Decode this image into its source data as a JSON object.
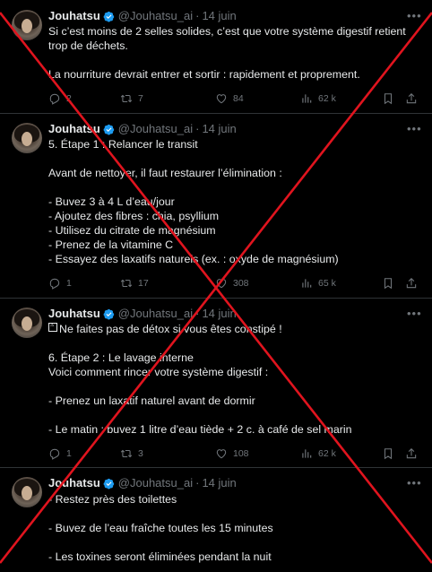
{
  "tweets": [
    {
      "name": "Jouhatsu",
      "handle": "@Jouhatsu_ai",
      "sep": "·",
      "date": "14 juin",
      "body": "Si c’est moins de 2 selles solides, c’est que votre système digestif retient trop de déchets.\n\nLa nourriture devrait entrer et sortir : rapidement et proprement.",
      "replies": "2",
      "retweets": "7",
      "likes": "84",
      "views": "62 k"
    },
    {
      "name": "Jouhatsu",
      "handle": "@Jouhatsu_ai",
      "sep": "·",
      "date": "14 juin",
      "body": "5. Étape 1 : Relancer le transit\n\nAvant de nettoyer, il faut restaurer l’élimination :\n\n- Buvez 3 à 4 L d’eau/jour\n- Ajoutez des fibres : chia, psyllium\n- Utilisez du citrate de magnésium\n- Prenez de la vitamine C\n- Essayez des laxatifs naturels (ex. : oxyde de magnésium)",
      "replies": "1",
      "retweets": "17",
      "likes": "308",
      "views": "65 k"
    },
    {
      "name": "Jouhatsu",
      "handle": "@Jouhatsu_ai",
      "sep": "·",
      "date": "14 juin",
      "emoji": "⚠",
      "body": "Ne faites pas de détox si vous êtes constipé !\n\n6. Étape 2 : Le lavage interne\nVoici comment rincer votre système digestif :\n\n- Prenez un laxatif naturel avant de dormir\n\n- Le matin : buvez 1 litre d’eau tiède + 2 c. à café de sel marin",
      "replies": "1",
      "retweets": "3",
      "likes": "108",
      "views": "62 k"
    },
    {
      "name": "Jouhatsu",
      "handle": "@Jouhatsu_ai",
      "sep": "·",
      "date": "14 juin",
      "body": "- Restez près des toilettes\n\n- Buvez de l’eau fraîche toutes les 15 minutes\n\n- Les toxines seront éliminées pendant la nuit"
    }
  ],
  "colors": {
    "background": "#000000",
    "text": "#e7e9ea",
    "muted": "#71767b",
    "verified": "#1d9bf0",
    "cross": "#e0141e",
    "divider": "#2f3336"
  },
  "icons": [
    "verified-badge-icon",
    "more-icon",
    "reply-icon",
    "retweet-icon",
    "like-icon",
    "views-icon",
    "bookmark-icon",
    "share-icon"
  ]
}
